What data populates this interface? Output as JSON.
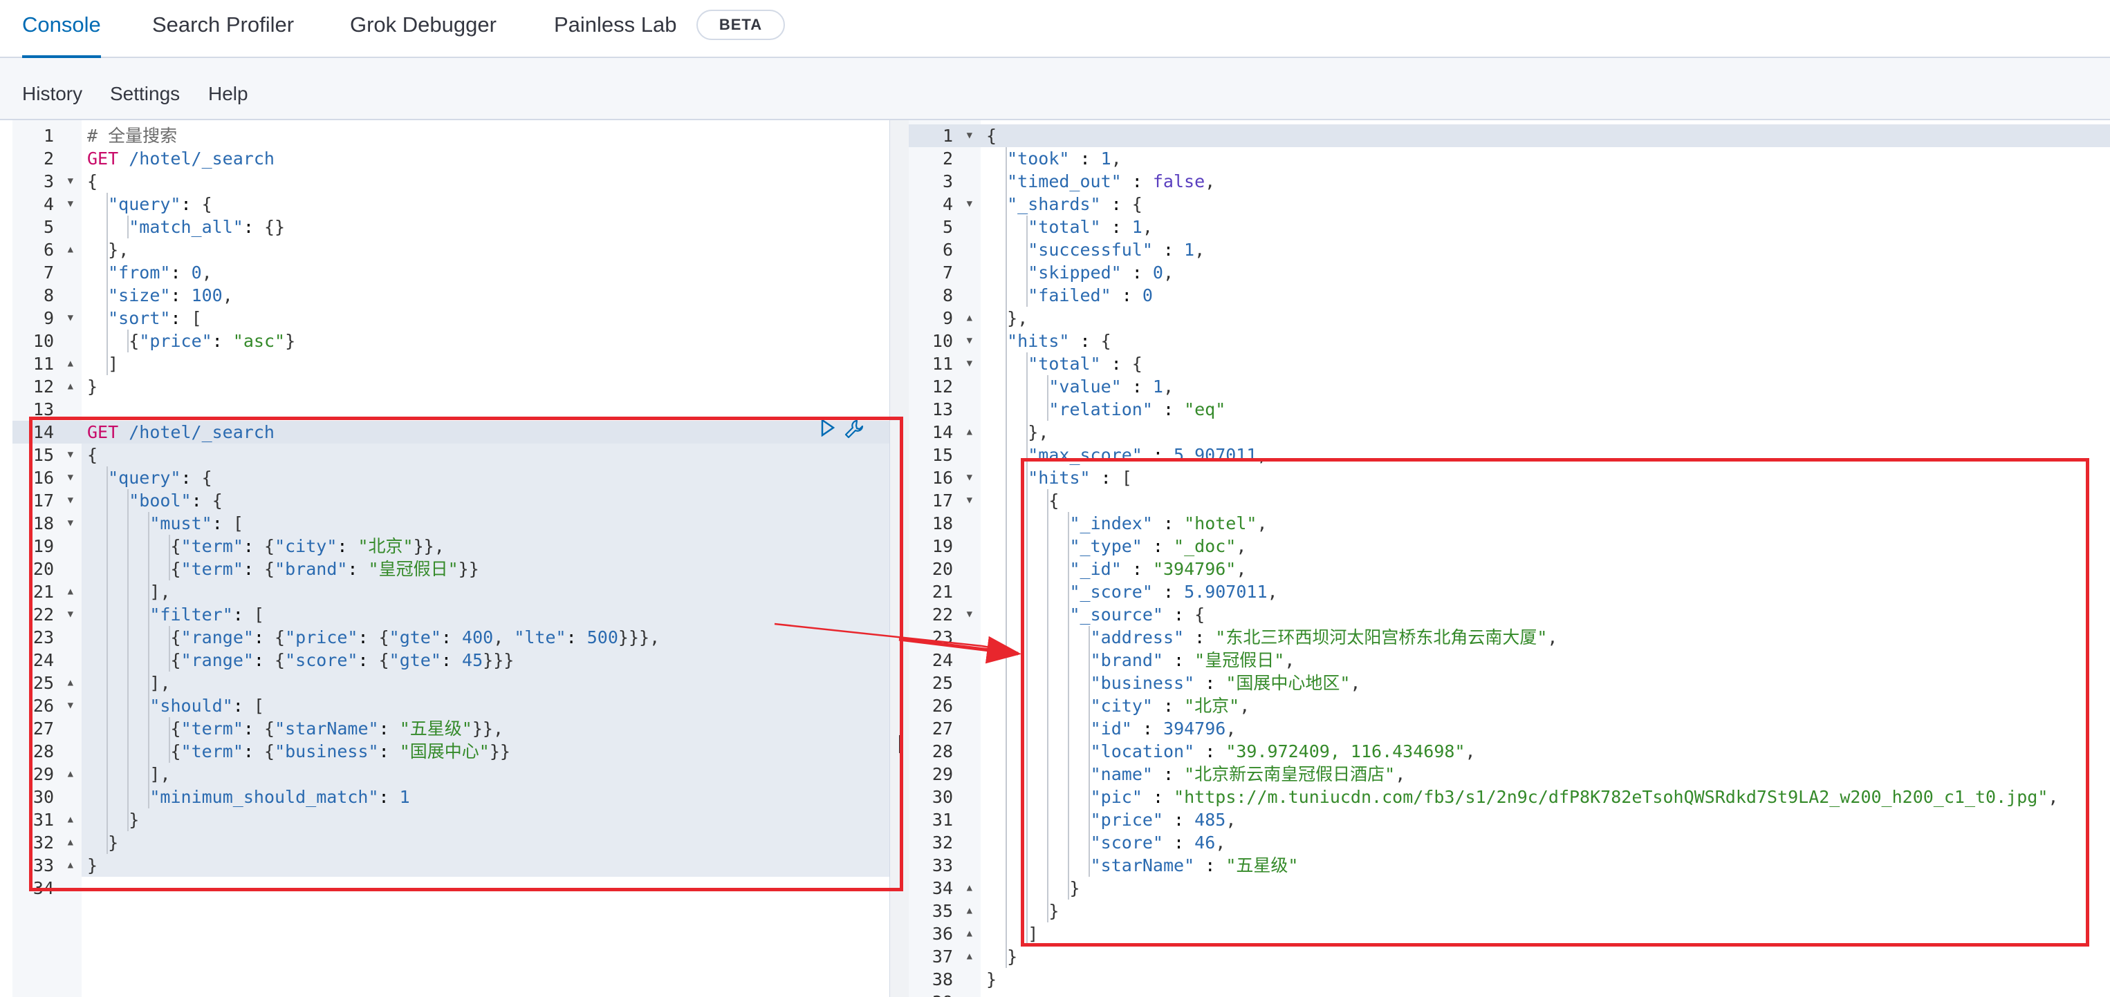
{
  "tabs": [
    {
      "label": "Console",
      "active": true
    },
    {
      "label": "Search Profiler",
      "active": false
    },
    {
      "label": "Grok Debugger",
      "active": false
    },
    {
      "label": "Painless Lab",
      "active": false
    }
  ],
  "beta_badge": "BETA",
  "menu": [
    "History",
    "Settings",
    "Help"
  ],
  "colors": {
    "accent": "#006bb4",
    "annotation_red": "#e8262d",
    "method": "#c80a68",
    "string": "#358a2a",
    "keyword": "#2a6ab0"
  },
  "icons": [
    "play-icon",
    "wrench-icon",
    "fold-arrow-icon"
  ],
  "request": {
    "lines": [
      "# 全量搜索",
      "GET /hotel/_search",
      "{",
      "  \"query\": {",
      "    \"match_all\": {}",
      "  },",
      "  \"from\": 0,",
      "  \"size\": 100,",
      "  \"sort\": [",
      "    {\"price\": \"asc\"}",
      "  ]",
      "}",
      "",
      "GET /hotel/_search",
      "{",
      "  \"query\": {",
      "    \"bool\": {",
      "      \"must\": [",
      "        {\"term\": {\"city\": \"北京\"}},",
      "        {\"term\": {\"brand\": \"皇冠假日\"}}",
      "      ],",
      "      \"filter\": [",
      "        {\"range\": {\"price\": {\"gte\": 400, \"lte\": 500}}},",
      "        {\"range\": {\"score\": {\"gte\": 45}}}",
      "      ],",
      "      \"should\": [",
      "        {\"term\": {\"starName\": \"五星级\"}},",
      "        {\"term\": {\"business\": \"国展中心\"}}",
      "      ],",
      "      \"minimum_should_match\": 1",
      "    }",
      "  }",
      "}",
      ""
    ],
    "fold_open": [
      3,
      4,
      9,
      15,
      16,
      17,
      18,
      22,
      26
    ],
    "fold_close": [
      6,
      11,
      12,
      21,
      25,
      29,
      31,
      32,
      33
    ],
    "active_line": 14,
    "selected_range": [
      14,
      33
    ]
  },
  "response": {
    "lines": [
      "{",
      "  \"took\" : 1,",
      "  \"timed_out\" : false,",
      "  \"_shards\" : {",
      "    \"total\" : 1,",
      "    \"successful\" : 1,",
      "    \"skipped\" : 0,",
      "    \"failed\" : 0",
      "  },",
      "  \"hits\" : {",
      "    \"total\" : {",
      "      \"value\" : 1,",
      "      \"relation\" : \"eq\"",
      "    },",
      "    \"max_score\" : 5.907011,",
      "    \"hits\" : [",
      "      {",
      "        \"_index\" : \"hotel\",",
      "        \"_type\" : \"_doc\",",
      "        \"_id\" : \"394796\",",
      "        \"_score\" : 5.907011,",
      "        \"_source\" : {",
      "          \"address\" : \"东北三环西坝河太阳宫桥东北角云南大厦\",",
      "          \"brand\" : \"皇冠假日\",",
      "          \"business\" : \"国展中心地区\",",
      "          \"city\" : \"北京\",",
      "          \"id\" : 394796,",
      "          \"location\" : \"39.972409, 116.434698\",",
      "          \"name\" : \"北京新云南皇冠假日酒店\",",
      "          \"pic\" : \"https://m.tuniucdn.com/fb3/s1/2n9c/dfP8K782eTsohQWSRdkd7St9LA2_w200_h200_c1_t0.jpg\",",
      "          \"price\" : 485,",
      "          \"score\" : 46,",
      "          \"starName\" : \"五星级\"",
      "        }",
      "      }",
      "    ]",
      "  }",
      "}",
      ""
    ],
    "fold_open": [
      1,
      4,
      10,
      11,
      16,
      17,
      22
    ],
    "fold_close": [
      9,
      14,
      34,
      35,
      36,
      37
    ],
    "active_line": 1
  }
}
